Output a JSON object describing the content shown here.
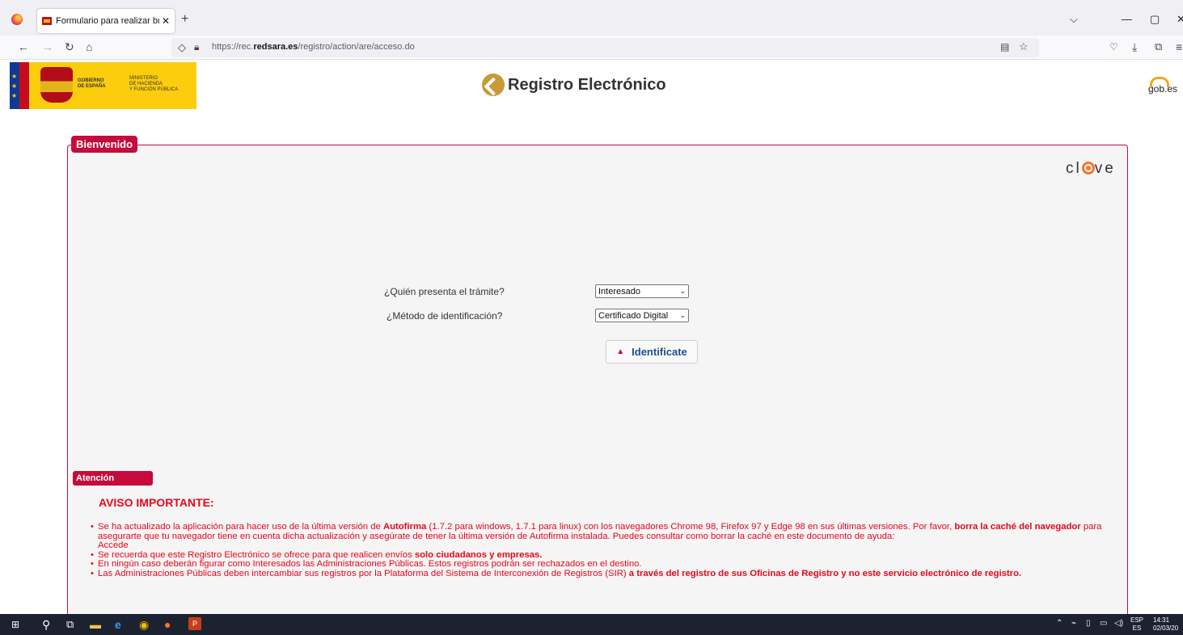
{
  "browser": {
    "tab_title": "Formulario para realizar búsque",
    "tab_close": "✕",
    "new_tab": "+",
    "list_all_tabs": "⌵",
    "window_controls": [
      "—",
      "▢",
      "✕"
    ],
    "url_prefix": "https://rec.",
    "url_domain": "redsara.es",
    "url_path": "/registro/action/are/acceso.do",
    "nav_icons": [
      "back-icon",
      "forward-icon",
      "reload-icon",
      "home-icon",
      "shield-icon",
      "lock-icon",
      "reader-view-icon",
      "bookmark-star-icon",
      "pocket-icon",
      "download-icon",
      "extensions-icon",
      "menu-icon"
    ]
  },
  "header": {
    "gov_line1": "GOBIERNO",
    "gov_line2": "DE ESPAÑA",
    "ministry_line1": "MINISTERIO",
    "ministry_line2": "DE HACIENDA",
    "ministry_line3": "Y FUNCIÓN PÚBLICA",
    "title": "Registro Electrónico",
    "gob_es": "gob.es"
  },
  "panel": {
    "legend": "Bienvenido",
    "clave_left": "cl",
    "clave_right": "ve",
    "question1": "¿Quién presenta el trámite?",
    "question1_value": "Interesado",
    "question2": "¿Método de identificación?",
    "question2_value": "Certificado Digital",
    "identify_button": "Identificate"
  },
  "attention": {
    "legend": "Atención",
    "heading": "AVISO IMPORTANTE:",
    "note1_a": "Se ha actualizado la aplicación para hacer uso de la última versión de ",
    "note1_b": "Autofirma",
    "note1_c": " (1.7.2 para windows, 1.7.1 para linux) con los navegadores Chrome 98, Firefox 97 y Edge 98 en sus últimas versiones. Por favor, ",
    "note1_d": "borra la caché del navegador",
    "note1_e": " para asegurarte que tu navegador tiene en cuenta dicha actualización y asegúrate de tener la última versión de Autofirma instalada. Puedes consultar como borrar la caché en este documento de ayuda:",
    "note1_link": "Accede",
    "note2_a": "Se recuerda que este Registro Electrónico se ofrece para que realicen envíos ",
    "note2_b": "solo ciudadanos y empresas.",
    "note3": "En ningún caso deberán figurar como Interesados las Administraciones Públicas. Estos registros podrán ser rechazados en el destino.",
    "note4_a": "Las Administraciones Públicas deben intercambiar sus registros por la Plataforma del Sistema de Interconexión de Registros (SIR) ",
    "note4_b": "a través del registro de sus Oficinas de Registro y no este servicio electrónico de registro."
  },
  "taskbar": {
    "lang_top": "ESP",
    "lang_bottom": "ES",
    "time": "14:31",
    "date": "02/03/20",
    "apps": [
      "start-icon",
      "search-icon",
      "task-view-icon",
      "file-explorer-icon",
      "internet-explorer-icon",
      "chrome-icon",
      "firefox-icon",
      "powerpoint-icon"
    ]
  }
}
